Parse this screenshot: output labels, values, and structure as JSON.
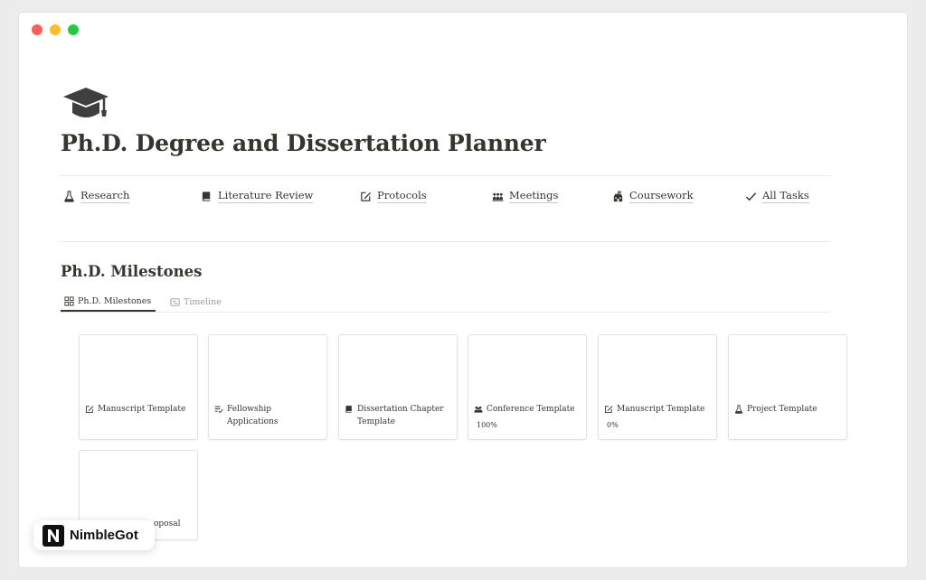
{
  "page": {
    "icon": "graduation-cap-icon",
    "title": "Ph.D. Degree and Dissertation Planner"
  },
  "nav": [
    {
      "label": "Research",
      "icon": "flask-icon"
    },
    {
      "label": "Literature Review",
      "icon": "book-icon"
    },
    {
      "label": "Protocols",
      "icon": "edit-icon"
    },
    {
      "label": "Meetings",
      "icon": "people-icon"
    },
    {
      "label": "Coursework",
      "icon": "school-icon"
    },
    {
      "label": "All Tasks",
      "icon": "check-icon"
    }
  ],
  "milestones": {
    "title": "Ph.D. Milestones",
    "tabs": [
      {
        "label": "Ph.D. Milestones",
        "icon": "gallery-icon",
        "active": true
      },
      {
        "label": "Timeline",
        "icon": "timeline-icon",
        "active": false
      }
    ],
    "cards": [
      {
        "title": "Manuscript Template",
        "icon": "edit-icon",
        "progress": ""
      },
      {
        "title": "Fellowship Applications",
        "icon": "checklist-icon",
        "progress": ""
      },
      {
        "title": "Dissertation Chapter Template",
        "icon": "book-icon",
        "progress": ""
      },
      {
        "title": "Conference Template",
        "icon": "people-icon",
        "progress": "100%"
      },
      {
        "title": "Manuscript Template",
        "icon": "edit-icon",
        "progress": "0%"
      },
      {
        "title": "Project Template",
        "icon": "flask-icon",
        "progress": ""
      },
      {
        "title": "oposal",
        "icon": "",
        "progress": ""
      }
    ]
  },
  "badge": {
    "logo": "N",
    "text": "NimbleGot"
  },
  "colors": {
    "text": "#37352f",
    "muted": "#9b9a97",
    "border": "#e3e2df"
  }
}
